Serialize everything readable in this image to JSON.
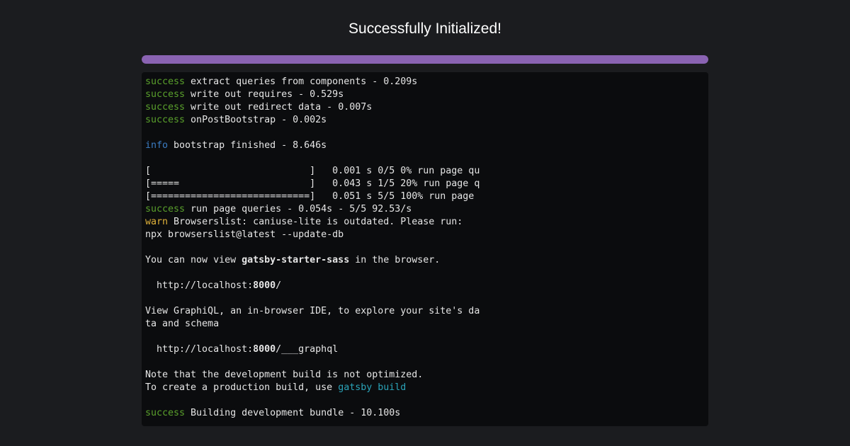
{
  "title": "Successfully Initialized!",
  "progress": {
    "value": 1.0,
    "color": "#8a63b2"
  },
  "colors": {
    "success": "#5aa02c",
    "info": "#3b7dc4",
    "warn": "#e0b23a",
    "link": "#2aa3b8",
    "text": "#e6e6e6",
    "spinner": "#9a9a9a"
  },
  "terminal": {
    "lines": [
      [
        {
          "t": "success",
          "c": "success"
        },
        {
          "t": " extract queries from components - 0.209s"
        }
      ],
      [
        {
          "t": "success",
          "c": "success"
        },
        {
          "t": " write out requires - 0.529s"
        }
      ],
      [
        {
          "t": "success",
          "c": "success"
        },
        {
          "t": " write out redirect data - 0.007s"
        }
      ],
      [
        {
          "t": "success",
          "c": "success"
        },
        {
          "t": " onPostBootstrap - 0.002s"
        }
      ],
      [
        {
          "t": "⠀",
          "c": "spinner"
        }
      ],
      [
        {
          "t": "info",
          "c": "info"
        },
        {
          "t": " bootstrap finished - 8.646s"
        }
      ],
      [
        {
          "t": "⠀",
          "c": "spinner"
        }
      ],
      [
        {
          "t": "[                            ]   0.001 s 0/5 0% run page qu"
        }
      ],
      [
        {
          "t": "[=====                       ]   0.043 s 1/5 20% run page q"
        }
      ],
      [
        {
          "t": "[============================]   0.051 s 5/5 100% run page"
        }
      ],
      [
        {
          "t": "success",
          "c": "success"
        },
        {
          "t": " run page queries - 0.054s - 5/5 92.53/s"
        }
      ],
      [
        {
          "t": "warn",
          "c": "warn"
        },
        {
          "t": " Browserslist: caniuse-lite is outdated. Please run:"
        }
      ],
      [
        {
          "t": "npx browserslist@latest --update-db"
        }
      ],
      [
        {
          "t": "⠀",
          "c": "spinner"
        }
      ],
      [
        {
          "t": "You can now view "
        },
        {
          "t": "gatsby-starter-sass",
          "b": true
        },
        {
          "t": " in the browser."
        }
      ],
      [
        {
          "t": "⠀",
          "c": "spinner"
        }
      ],
      [
        {
          "t": "  http://localhost:"
        },
        {
          "t": "8000",
          "b": true
        },
        {
          "t": "/"
        }
      ],
      [
        {
          "t": "⠀",
          "c": "spinner"
        }
      ],
      [
        {
          "t": "View GraphiQL, an in-browser IDE, to explore your site's da"
        }
      ],
      [
        {
          "t": "ta and schema"
        }
      ],
      [
        {
          "t": "⠀",
          "c": "spinner"
        }
      ],
      [
        {
          "t": "  http://localhost:"
        },
        {
          "t": "8000",
          "b": true
        },
        {
          "t": "/___graphql"
        }
      ],
      [
        {
          "t": "⠀",
          "c": "spinner"
        }
      ],
      [
        {
          "t": "Note that the development build is not optimized."
        }
      ],
      [
        {
          "t": "To create a production build, use "
        },
        {
          "t": "gatsby build",
          "c": "link"
        }
      ],
      [
        {
          "t": "⠀",
          "c": "spinner"
        }
      ],
      [
        {
          "t": "success",
          "c": "success"
        },
        {
          "t": " Building development bundle - 10.100s"
        }
      ]
    ]
  }
}
